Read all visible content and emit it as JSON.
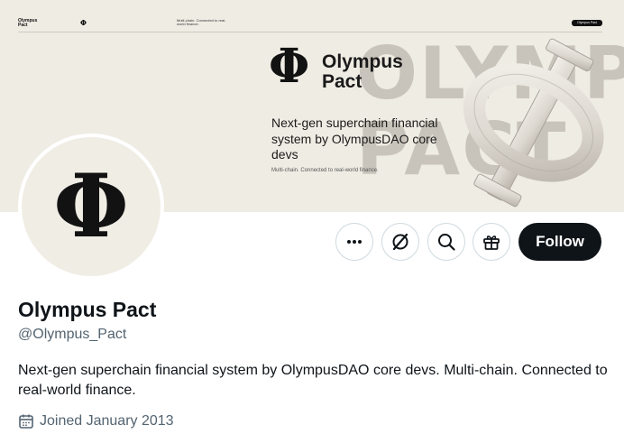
{
  "banner": {
    "mini_logo": "Olympus Pact",
    "mini_symbol": "Φ",
    "mini_tagline": "Multi-chain. Connected to real-world finance.",
    "mini_pill": "Olympus Pact",
    "background_letters": "OLYMPUS PACT",
    "logo_symbol": "Φ",
    "logo_name": "Olympus Pact",
    "headline": "Next-gen superchain financial system by OlympusDAO core devs",
    "subline": "Multi-chain. Connected to real-world finance."
  },
  "avatar": {
    "symbol": "Φ"
  },
  "actions": {
    "more_icon": "more-icon",
    "grok_icon": "grok-icon",
    "search_icon": "search-icon",
    "gift_icon": "gift-icon",
    "follow_label": "Follow"
  },
  "profile": {
    "name": "Olympus Pact",
    "handle": "@Olympus_Pact",
    "bio": "Next-gen superchain financial system by OlympusDAO core devs. Multi-chain. Connected to real-world finance.",
    "joined": "Joined January 2013"
  },
  "colors": {
    "banner_bg": "#efece4",
    "follow_bg": "#0f1419",
    "secondary_text": "#536471"
  }
}
